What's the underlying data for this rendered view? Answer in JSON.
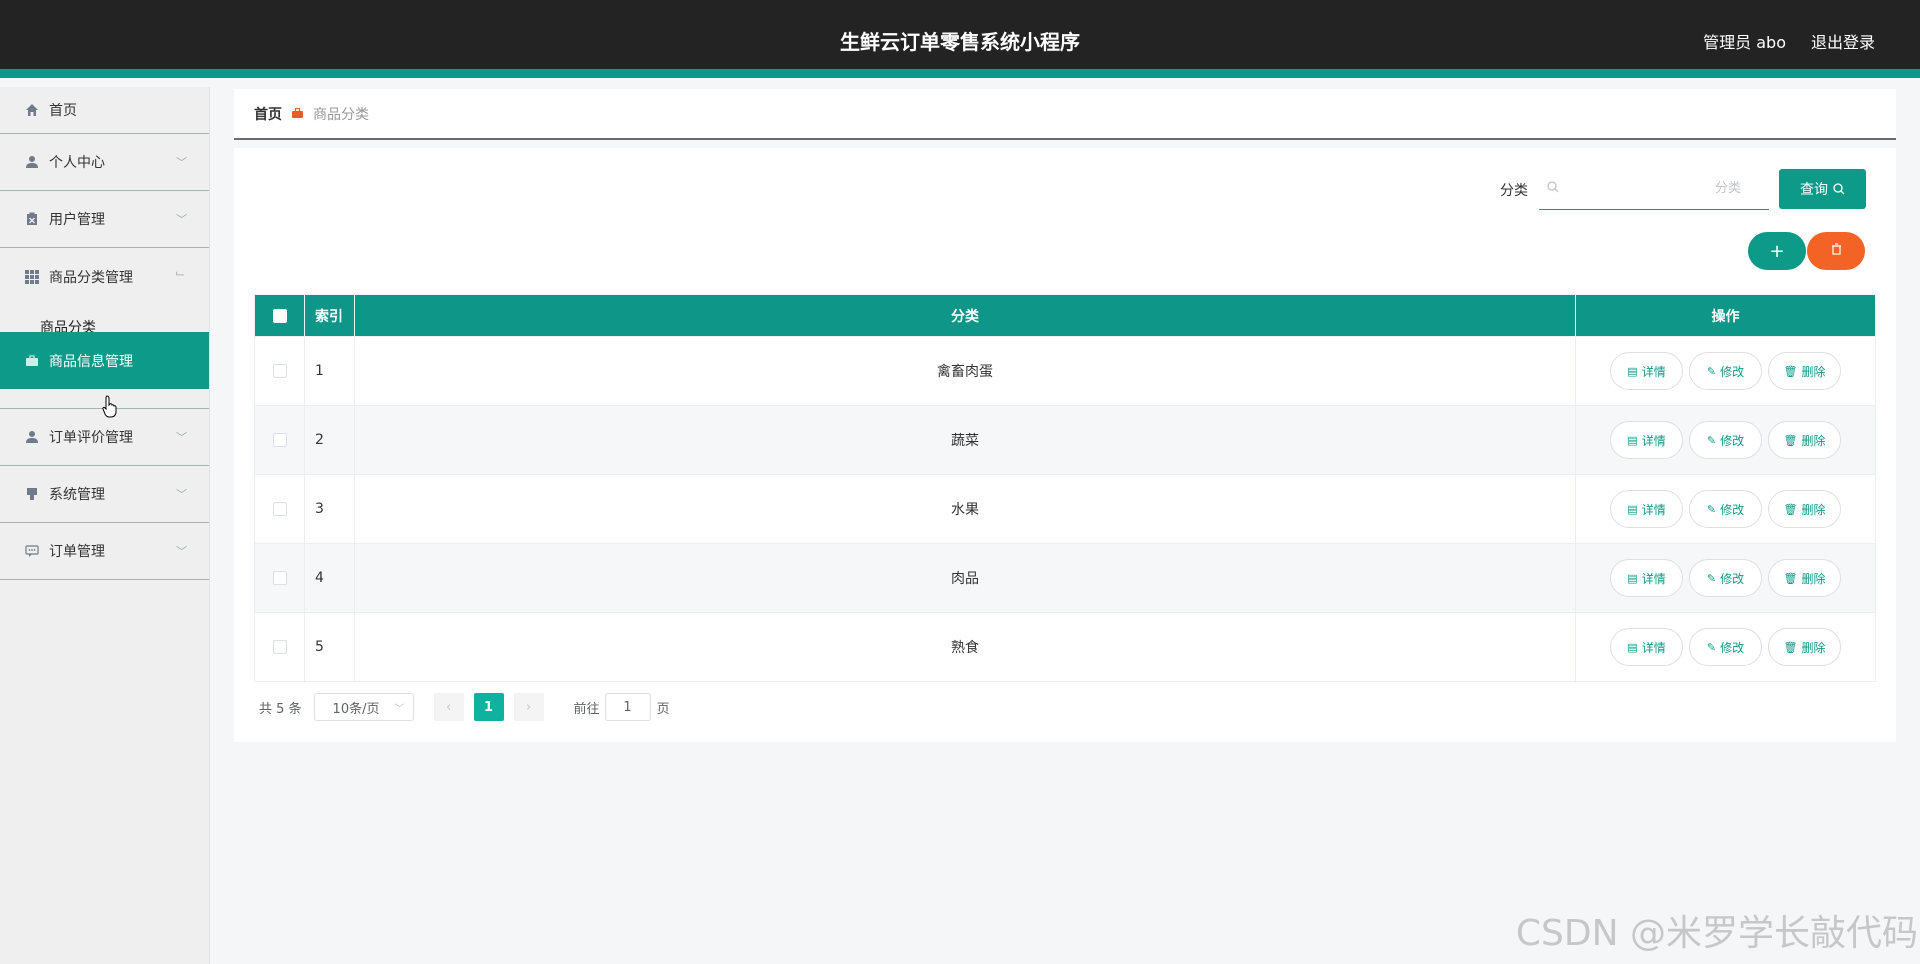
{
  "header": {
    "title": "生鲜云订单零售系统小程序",
    "user": "管理员 abo",
    "logout": "退出登录"
  },
  "sidebar": {
    "items": [
      {
        "label": "首页",
        "icon": "home-icon"
      },
      {
        "label": "个人中心",
        "icon": "user-icon"
      },
      {
        "label": "用户管理",
        "icon": "clipboard-icon"
      },
      {
        "label": "商品分类管理",
        "icon": "grid-icon"
      },
      {
        "label": "商品分类",
        "icon": ""
      },
      {
        "label": "商品信息管理",
        "icon": "briefcase-icon"
      },
      {
        "label": "订单评价管理",
        "icon": "user-icon"
      },
      {
        "label": "系统管理",
        "icon": "bookmark-icon"
      },
      {
        "label": "订单管理",
        "icon": "chat-icon"
      }
    ]
  },
  "breadcrumb": {
    "home": "首页",
    "current": "商品分类"
  },
  "search": {
    "label": "分类",
    "placeholder": "分类",
    "button": "查询"
  },
  "toolbar": {
    "add": "+",
    "delete": "🗑"
  },
  "table": {
    "headers": {
      "index": "索引",
      "category": "分类",
      "ops": "操作"
    },
    "rows": [
      {
        "index": "1",
        "category": "禽畜肉蛋"
      },
      {
        "index": "2",
        "category": "蔬菜"
      },
      {
        "index": "3",
        "category": "水果"
      },
      {
        "index": "4",
        "category": "肉品"
      },
      {
        "index": "5",
        "category": "熟食"
      }
    ],
    "ops": {
      "detail": "详情",
      "edit": "修改",
      "delete": "删除"
    }
  },
  "pager": {
    "total": "共 5 条",
    "size": "10条/页",
    "current": "1",
    "goto": "前往",
    "goto_value": "1",
    "unit": "页"
  },
  "watermark": "CSDN @米罗学长敲代码",
  "colors": {
    "accent": "#0e9a88",
    "danger": "#f26325",
    "header": "#232323"
  }
}
